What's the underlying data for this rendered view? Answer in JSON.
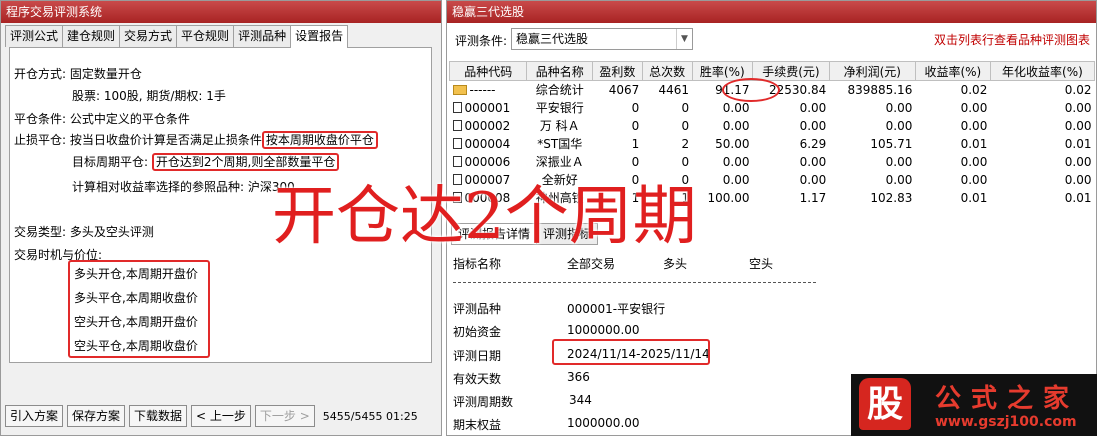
{
  "left": {
    "title": "程序交易评测系统",
    "tabs": [
      "评测公式",
      "建仓规则",
      "交易方式",
      "平仓规则",
      "评测品种",
      "设置报告"
    ],
    "active_tab": 5,
    "open_mode_label": "开仓方式:",
    "open_mode_value": "固定数量开仓",
    "qty_text": "股票: 100股, 期货/期权: 1手",
    "close_cond_label": "平仓条件:",
    "close_cond_value": "公式中定义的平仓条件",
    "stoploss_label": "止损平仓:",
    "stoploss_text": "按当日收盘价计算是否满足止损条件",
    "stoploss_highlight": "按本周期收盘价平仓",
    "target_label": "目标周期平仓:",
    "target_highlight": "开仓达到2个周期,则全部数量平仓",
    "ref_text": "计算相对收益率选择的参照品种: 沪深300",
    "trade_type_label": "交易类型:",
    "trade_type_value": "多头及空头评测",
    "timing_label": "交易时机与价位:",
    "timing_items": [
      "多头开仓,本周期开盘价",
      "多头平仓,本周期收盘价",
      "空头开仓,本周期开盘价",
      "空头平仓,本周期收盘价"
    ],
    "buttons": {
      "import": "引入方案",
      "save": "保存方案",
      "download": "下载数据",
      "prev": "< 上一步",
      "next": "下一步 >"
    },
    "status": "5455/5455 01:25"
  },
  "right": {
    "title": "稳赢三代选股",
    "criteria_label": "评测条件:",
    "criteria_value": "稳赢三代选股",
    "hint": "双击列表行查看品种评测图表",
    "columns": [
      "品种代码",
      "品种名称",
      "盈利数",
      "总次数",
      "胜率(%)",
      "手续费(元)",
      "净利润(元)",
      "收益率(%)",
      "年化收益率(%)"
    ],
    "rows": [
      [
        "------",
        "综合统计",
        "4067",
        "4461",
        "91.17",
        "22530.84",
        "839885.16",
        "0.02",
        "0.02"
      ],
      [
        "000001",
        "平安银行",
        "0",
        "0",
        "0.00",
        "0.00",
        "0.00",
        "0.00",
        "0.00"
      ],
      [
        "000002",
        "万 科Ａ",
        "0",
        "0",
        "0.00",
        "0.00",
        "0.00",
        "0.00",
        "0.00"
      ],
      [
        "000004",
        "*ST国华",
        "1",
        "2",
        "50.00",
        "6.29",
        "105.71",
        "0.01",
        "0.01"
      ],
      [
        "000006",
        "深振业Ａ",
        "0",
        "0",
        "0.00",
        "0.00",
        "0.00",
        "0.00",
        "0.00"
      ],
      [
        "000007",
        "全新好",
        "0",
        "0",
        "0.00",
        "0.00",
        "0.00",
        "0.00",
        "0.00"
      ],
      [
        "000008",
        "神州高铁",
        "1",
        "1",
        "100.00",
        "1.17",
        "102.83",
        "0.01",
        "0.01"
      ]
    ],
    "bottom_tabs": [
      "评测报告详情",
      "评测指标"
    ],
    "summary_header": [
      "指标名称",
      "全部交易",
      "多头",
      "空头"
    ],
    "summary": [
      {
        "label": "评测品种",
        "value": "000001-平安银行"
      },
      {
        "label": "初始资金",
        "value": "1000000.00"
      },
      {
        "label": "评测日期",
        "value": "2024/11/14-2025/11/14"
      },
      {
        "label": "有效天数",
        "value": "366"
      },
      {
        "label": "评测周期数",
        "value": "344"
      },
      {
        "label": "期末权益",
        "value": "1000000.00"
      }
    ]
  },
  "overlay_caption": "开仓达2个周期",
  "logo": {
    "mark": "股",
    "name": "公式之家",
    "url": "www.gszj100.com"
  },
  "colors": {
    "highlight": "#e12a2a",
    "titlebar": "#b83232",
    "hint": "#c00000"
  }
}
